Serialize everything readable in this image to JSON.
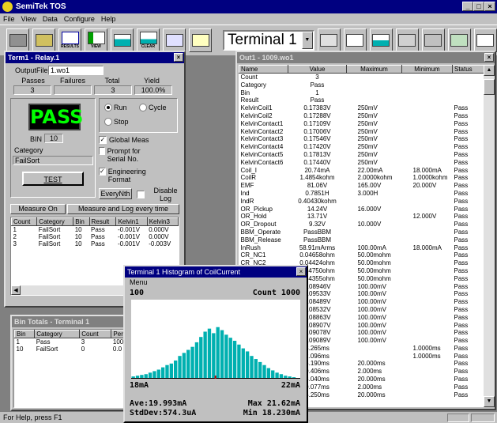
{
  "app": {
    "title": "SemiTek TOS"
  },
  "menu": [
    "File",
    "View",
    "Data",
    "Configure",
    "Help"
  ],
  "toolbar": {
    "terminal": "Terminal 1",
    "labels": {
      "results": "RESULTS",
      "view": "VIEW",
      "clear": "CLEAR"
    }
  },
  "term_window": {
    "title": "Term1 - Relay.1",
    "output_file_label": "OutputFile:",
    "output_file": "1.wo1",
    "headers": [
      "Passes",
      "Failures",
      "Total",
      "Yield"
    ],
    "values": [
      "3",
      "",
      "3",
      "100.0%"
    ],
    "result": "PASS",
    "bin_label": "BIN",
    "bin_value": "10",
    "category_label": "Category",
    "category_value": "FailSort",
    "test_button": "TEST",
    "run_label": "Run",
    "cycle_label": "Cycle",
    "stop_label": "Stop",
    "global_meas": "Global Meas",
    "prompt_serial": "Prompt for Serial No.",
    "eng_format": "Engineering Format",
    "every_nth": "EveryNth",
    "disable_log": "Disable Log",
    "measure_on": "Measure On",
    "measure_mode": "Measure and Log every time",
    "log_columns": [
      "Count",
      "Category",
      "Bin",
      "Result",
      "Kelvin1",
      "Kelvin3"
    ],
    "log_rows": [
      [
        "1",
        "FailSort",
        "10",
        "Pass",
        "-0.001V",
        "0.000V"
      ],
      [
        "2",
        "FailSort",
        "10",
        "Pass",
        "-0.001V",
        "0.000V"
      ],
      [
        "3",
        "FailSort",
        "10",
        "Pass",
        "-0.001V",
        "-0.003V"
      ]
    ]
  },
  "bin_totals": {
    "title": "Bin Totals - Terminal 1",
    "columns": [
      "Bin",
      "Category",
      "Count",
      "Per"
    ],
    "rows": [
      [
        "1",
        "Pass",
        "3",
        "100"
      ],
      [
        "10",
        "FailSort",
        "0",
        "0.0"
      ]
    ]
  },
  "results_window": {
    "title": "Out1 - 1009.wo1",
    "columns": [
      "Name",
      "Value",
      "Maximum",
      "Minimum",
      "Status"
    ],
    "rows": [
      [
        "Count",
        "3",
        "",
        "",
        ""
      ],
      [
        "Category",
        "Pass",
        "",
        "",
        ""
      ],
      [
        "Bin",
        "1",
        "",
        "",
        ""
      ],
      [
        "Result",
        "Pass",
        "",
        "",
        ""
      ],
      [
        "KelvinCoil1",
        "0.17383V",
        "250mV",
        "",
        "Pass"
      ],
      [
        "KelvinCoil2",
        "0.17288V",
        "250mV",
        "",
        "Pass"
      ],
      [
        "KelvinContact1",
        "0.17109V",
        "250mV",
        "",
        "Pass"
      ],
      [
        "KelvinContact2",
        "0.17006V",
        "250mV",
        "",
        "Pass"
      ],
      [
        "KelvinContact3",
        "0.17546V",
        "250mV",
        "",
        "Pass"
      ],
      [
        "KelvinContact4",
        "0.17420V",
        "250mV",
        "",
        "Pass"
      ],
      [
        "KelvinContact5",
        "0.17813V",
        "250mV",
        "",
        "Pass"
      ],
      [
        "KelvinContact6",
        "0.17440V",
        "250mV",
        "",
        "Pass"
      ],
      [
        "Coil_I",
        "20.74mA",
        "22.00mA",
        "18.000mA",
        "Pass"
      ],
      [
        "CoilR",
        "1.4854kohm",
        "2.0000kohm",
        "1.0000kohm",
        "Pass"
      ],
      [
        "EMF",
        "81.06V",
        "165.00V",
        "20.000V",
        "Pass"
      ],
      [
        "Ind",
        "0.7851H",
        "3.000H",
        "",
        "Pass"
      ],
      [
        "IndR",
        "0.40430kohm",
        "",
        "",
        "Pass"
      ],
      [
        "OR_Pickup",
        "14.24V",
        "16.000V",
        "",
        "Pass"
      ],
      [
        "OR_Hold",
        "13.71V",
        "",
        "12.000V",
        "Pass"
      ],
      [
        "OR_Dropout",
        "9.32V",
        "10.000V",
        "",
        "Pass"
      ],
      [
        "BBM_Operate",
        "PassBBM",
        "",
        "",
        "Pass"
      ],
      [
        "BBM_Release",
        "PassBBM",
        "",
        "",
        "Pass"
      ],
      [
        "InRush",
        "58.91mArms",
        "100.00mA",
        "18.000mA",
        "Pass"
      ],
      [
        "CR_NC1",
        "0.04658ohm",
        "50.00mohm",
        "",
        "Pass"
      ],
      [
        "CR_NC2",
        "0.04424ohm",
        "50.00mohm",
        "",
        "Pass"
      ],
      [
        "",
        "0.04750ohm",
        "50.00mohm",
        "",
        "Pass"
      ],
      [
        "",
        "0.04355ohm",
        "50.00mohm",
        "",
        "Pass"
      ],
      [
        "",
        "0.08946V",
        "100.00mV",
        "",
        "Pass"
      ],
      [
        "",
        "0.09533V",
        "100.00mV",
        "",
        "Pass"
      ],
      [
        "",
        "0.08489V",
        "100.00mV",
        "",
        "Pass"
      ],
      [
        "",
        "0.08532V",
        "100.00mV",
        "",
        "Pass"
      ],
      [
        "",
        "0.08863V",
        "100.00mV",
        "",
        "Pass"
      ],
      [
        "",
        "0.08907V",
        "100.00mV",
        "",
        "Pass"
      ],
      [
        "",
        "0.09078V",
        "100.00mV",
        "",
        "Pass"
      ],
      [
        "",
        "0.09089V",
        "100.00mV",
        "",
        "Pass"
      ],
      [
        "",
        "3.265ms",
        "",
        "1.0000ms",
        "Pass"
      ],
      [
        "",
        "2.096ms",
        "",
        "1.0000ms",
        "Pass"
      ],
      [
        "",
        "5.190ms",
        "20.000ms",
        "",
        "Pass"
      ],
      [
        "",
        "0.406ms",
        "2.000ms",
        "",
        "Pass"
      ],
      [
        "",
        "3.040ms",
        "20.000ms",
        "",
        "Pass"
      ],
      [
        "",
        "0.077ms",
        "2.000ms",
        "",
        "Pass"
      ],
      [
        "",
        "5.250ms",
        "20.000ms",
        "",
        "Pass"
      ]
    ]
  },
  "histogram": {
    "title": "Terminal 1 Histogram of CoilCurrent",
    "menu": "Menu",
    "top_left": "100",
    "count": "Count 1000",
    "x_min": "18mA",
    "x_max": "22mA",
    "ave": "Ave:19.993mA",
    "max": "Max 21.62mA",
    "stddev": "StdDev:574.3uA",
    "min": "Min 18.230mA"
  },
  "chart_data": {
    "type": "bar",
    "title": "Terminal 1 Histogram of CoilCurrent",
    "xlim": [
      18,
      22
    ],
    "x_unit": "mA",
    "ylim": [
      0,
      100
    ],
    "values": [
      3,
      4,
      5,
      6,
      8,
      10,
      12,
      15,
      18,
      20,
      24,
      30,
      34,
      38,
      42,
      48,
      55,
      62,
      66,
      60,
      68,
      64,
      58,
      54,
      50,
      45,
      40,
      36,
      30,
      26,
      22,
      18,
      14,
      11,
      8,
      6,
      4,
      3,
      2,
      1
    ]
  },
  "status": {
    "help_text": "For Help, press F1"
  },
  "colors": {
    "titlebar": "#000080",
    "pass_text": "#00ff00",
    "bars": "#00b0b0"
  }
}
